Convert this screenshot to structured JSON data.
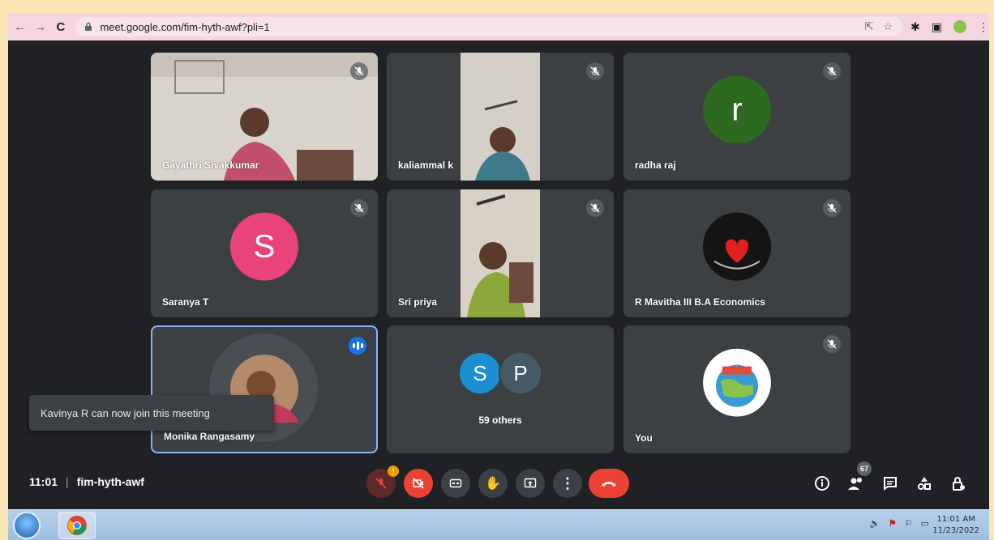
{
  "browser": {
    "url": "meet.google.com/fim-hyth-awf?pli=1",
    "nav_back_icon": "arrow-left-icon",
    "nav_forward_icon": "arrow-right-icon",
    "reload_icon": "reload-icon"
  },
  "tiles": [
    {
      "name": "Gayathri Sivakkumar",
      "type": "video"
    },
    {
      "name": "kaliammal k",
      "type": "video"
    },
    {
      "name": "radha raj",
      "type": "avatar",
      "initial": "r",
      "color": "#2d6a1f"
    },
    {
      "name": "Saranya T",
      "type": "avatar",
      "initial": "S",
      "color": "#e8437a"
    },
    {
      "name": "Sri priya",
      "type": "video"
    },
    {
      "name": "R Mavitha III B.A Economics",
      "type": "image"
    },
    {
      "name": "Monika Rangasamy",
      "type": "image",
      "speaking": true
    },
    {
      "name": "59 others",
      "type": "group",
      "initials": [
        "S",
        "P"
      ],
      "colors": [
        "#1b8fd1",
        "#455a64"
      ]
    },
    {
      "name": "You",
      "type": "image"
    }
  ],
  "toast": {
    "text": "Kavinya R can now join this meeting"
  },
  "meeting": {
    "time": "11:01",
    "separator": "|",
    "code": "fim-hyth-awf"
  },
  "participants_badge": "67",
  "taskbar": {
    "time": "11:01 AM",
    "date": "11/23/2022"
  },
  "colors": {
    "bg": "#202124",
    "tile": "#3c4043",
    "red": "#ea4335",
    "blue": "#1a73e8",
    "chrome": "#f5d6e0"
  }
}
